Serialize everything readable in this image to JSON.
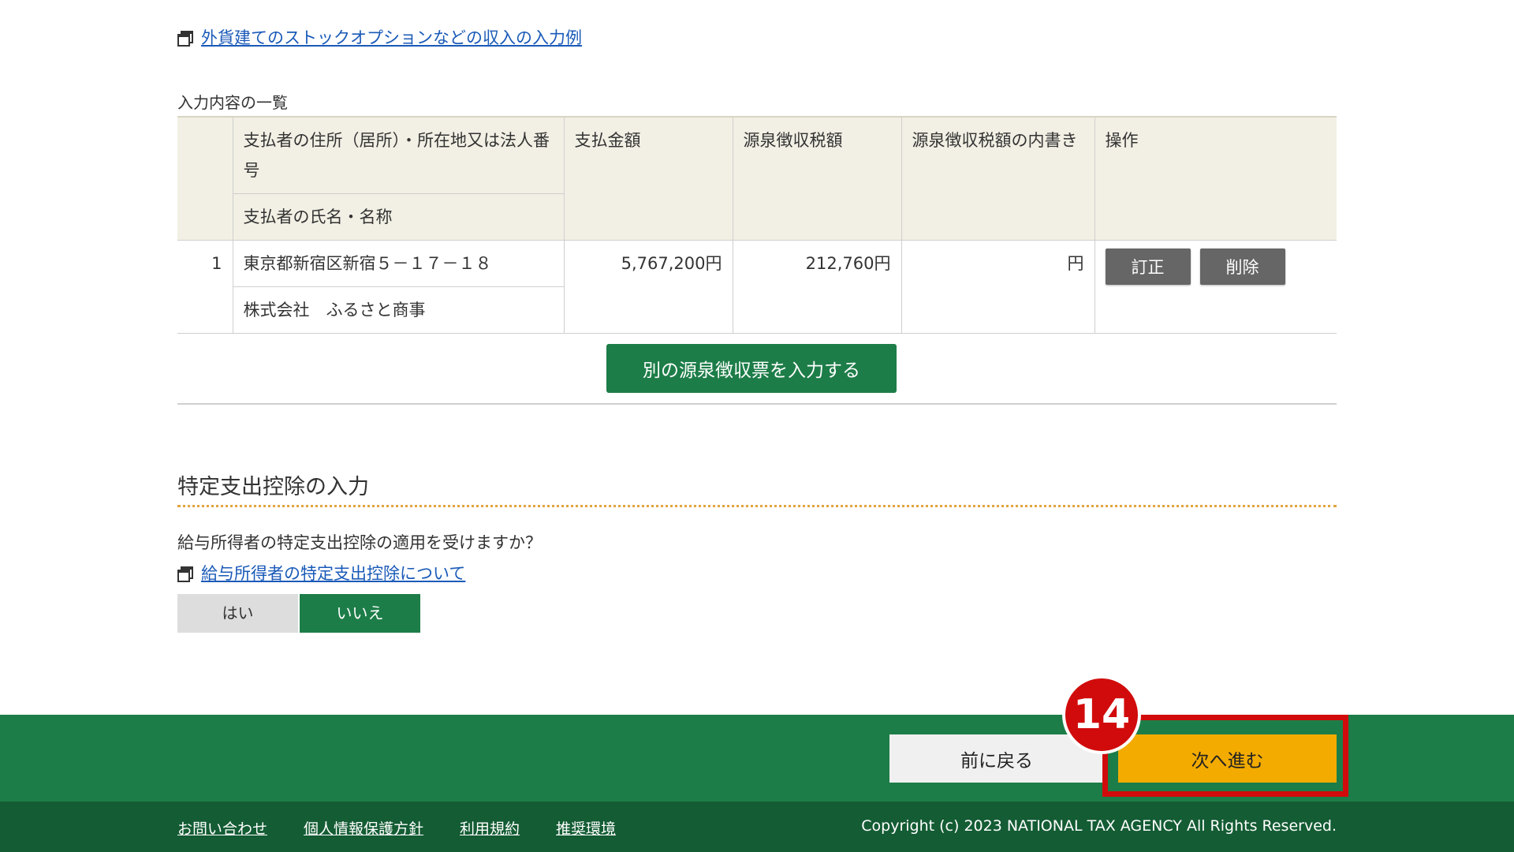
{
  "top_link": {
    "label": "外貨建てのストックオプションなどの収入の入力例"
  },
  "entries_section": {
    "caption": "入力内容の一覧",
    "headers": {
      "payer_address": "支払者の住所（居所）・所在地又は法人番号",
      "payer_name": "支払者の氏名・名称",
      "payment_amount": "支払金額",
      "withholding_tax": "源泉徴収税額",
      "withholding_inner": "源泉徴収税額の内書き",
      "operation": "操作"
    },
    "rows": [
      {
        "index": "1",
        "address": "東京都新宿区新宿５－１７－１８",
        "name": "株式会社　ふるさと商事",
        "payment": "5,767,200円",
        "tax": "212,760円",
        "inner": "円",
        "edit_label": "訂正",
        "delete_label": "削除"
      }
    ],
    "add_button": "別の源泉徴収票を入力する"
  },
  "specific_deduction": {
    "title": "特定支出控除の入力",
    "question": "給与所得者の特定支出控除の適用を受けますか？",
    "link": "給与所得者の特定支出控除について",
    "options": {
      "yes": "はい",
      "no": "いいえ"
    },
    "selected": "いいえ"
  },
  "action_bar": {
    "back_label": "前に戻る",
    "next_label": "次へ進む",
    "step_badge": "14"
  },
  "footer": {
    "links": [
      "お問い合わせ",
      "個人情報保護方針",
      "利用規約",
      "推奨環境"
    ],
    "copyright": "Copyright (c) 2023 NATIONAL TAX AGENCY All Rights Reserved."
  },
  "colors": {
    "primary_green": "#1d7d48",
    "footer_green": "#145c34",
    "next_button": "#f3ab00",
    "highlight_red": "#d10b0b",
    "table_header": "#f2efe4",
    "link_blue": "#1a5ab8"
  },
  "icons": {
    "external_link": "window-icon"
  }
}
